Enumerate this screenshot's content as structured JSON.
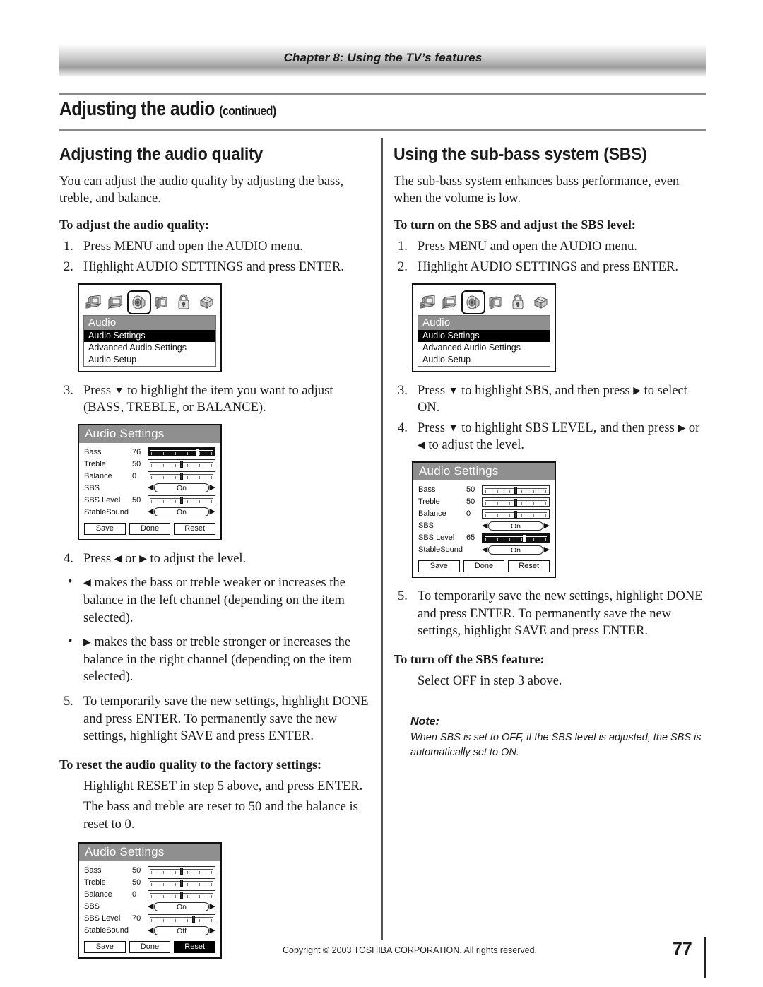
{
  "header": {
    "chapter": "Chapter 8: Using the TV’s features"
  },
  "title": {
    "main": "Adjusting the audio",
    "continued": "(continued)"
  },
  "left": {
    "heading": "Adjusting the audio quality",
    "intro": "You can adjust the audio quality by adjusting the bass, treble, and balance.",
    "subhead1": "To adjust the audio quality:",
    "step1": "Press MENU and open the AUDIO menu.",
    "step2": "Highlight AUDIO SETTINGS and press ENTER.",
    "step1_num": "1.",
    "step2_num": "2.",
    "step3_num": "3.",
    "step4_num": "4.",
    "step5_num": "5.",
    "step3_a": "Press",
    "step3_b": "to highlight the item you want to adjust (BASS, TREBLE, or BALANCE).",
    "step4_a": "Press",
    "step4_b": "or",
    "step4_c": "to adjust the level.",
    "bullet1": "makes the bass or treble weaker or increases the balance in the left channel (depending on the item selected).",
    "bullet2": "makes the bass or treble stronger or increases the balance in the right channel (depending on the item selected).",
    "step5": "To temporarily save the new settings, highlight DONE and press ENTER. To permanently save the new settings, highlight SAVE and press ENTER.",
    "subhead2": "To reset the audio quality to the factory settings:",
    "reset_line1": "Highlight RESET in step 5 above, and press ENTER.",
    "reset_line2": "The bass and treble are reset to 50 and the balance is reset to 0."
  },
  "right": {
    "heading": "Using the sub-bass system (SBS)",
    "intro": "The sub-bass system enhances bass performance, even when the volume is low.",
    "subhead1": "To turn on the SBS and adjust the SBS level:",
    "step1_num": "1.",
    "step2_num": "2.",
    "step3_num": "3.",
    "step4_num": "4.",
    "step5_num": "5.",
    "step1": "Press MENU and open the AUDIO menu.",
    "step2": "Highlight AUDIO SETTINGS and press ENTER.",
    "step3_a": "Press",
    "step3_b": "to highlight SBS, and then press",
    "step3_c": "to select ON.",
    "step4_a": "Press",
    "step4_b": "to highlight SBS LEVEL, and then press",
    "step4_c": "or",
    "step4_d": "to adjust the level.",
    "step5": "To temporarily save the new settings, highlight DONE and press ENTER. To permanently save the new settings, highlight SAVE and press ENTER.",
    "subhead2": "To turn off the SBS feature:",
    "turnoff_line": "Select OFF in step 3 above.",
    "note_title": "Note:",
    "note_body": "When SBS is set to OFF, if the SBS level is adjusted, the SBS is automatically set to ON."
  },
  "osd_menu": {
    "title": "Audio",
    "items": [
      "Audio Settings",
      "Advanced Audio Settings",
      "Audio Setup"
    ],
    "highlighted_index": 0,
    "icons": [
      "picture-icon",
      "tv-icon",
      "speaker-icon",
      "channels-icon",
      "lock-icon",
      "setup-icon"
    ],
    "selected_icon_index": 2
  },
  "panel_a": {
    "title": "Audio Settings",
    "rows": [
      {
        "label": "Bass",
        "value": "76",
        "type": "slider",
        "pct": 76,
        "selected": true
      },
      {
        "label": "Treble",
        "value": "50",
        "type": "slider",
        "pct": 50,
        "selected": false
      },
      {
        "label": "Balance",
        "value": "0",
        "type": "slider",
        "pct": 50,
        "selected": false
      },
      {
        "label": "SBS",
        "value": "",
        "type": "select",
        "option": "On",
        "selected": false
      },
      {
        "label": "SBS Level",
        "value": "50",
        "type": "slider",
        "pct": 50,
        "selected": false
      },
      {
        "label": "StableSound",
        "value": "",
        "type": "select",
        "option": "On",
        "selected": false
      }
    ],
    "buttons": [
      {
        "label": "Save",
        "highlighted": false
      },
      {
        "label": "Done",
        "highlighted": false
      },
      {
        "label": "Reset",
        "highlighted": false
      }
    ]
  },
  "panel_b": {
    "title": "Audio Settings",
    "rows": [
      {
        "label": "Bass",
        "value": "50",
        "type": "slider",
        "pct": 50,
        "selected": false
      },
      {
        "label": "Treble",
        "value": "50",
        "type": "slider",
        "pct": 50,
        "selected": false
      },
      {
        "label": "Balance",
        "value": "0",
        "type": "slider",
        "pct": 50,
        "selected": false
      },
      {
        "label": "SBS",
        "value": "",
        "type": "select",
        "option": "On",
        "selected": false
      },
      {
        "label": "SBS Level",
        "value": "65",
        "type": "slider",
        "pct": 65,
        "selected": true
      },
      {
        "label": "StableSound",
        "value": "",
        "type": "select",
        "option": "On",
        "selected": false
      }
    ],
    "buttons": [
      {
        "label": "Save",
        "highlighted": false
      },
      {
        "label": "Done",
        "highlighted": false
      },
      {
        "label": "Reset",
        "highlighted": false
      }
    ]
  },
  "panel_c": {
    "title": "Audio Settings",
    "rows": [
      {
        "label": "Bass",
        "value": "50",
        "type": "slider",
        "pct": 50,
        "selected": false
      },
      {
        "label": "Treble",
        "value": "50",
        "type": "slider",
        "pct": 50,
        "selected": false
      },
      {
        "label": "Balance",
        "value": "0",
        "type": "slider",
        "pct": 50,
        "selected": false
      },
      {
        "label": "SBS",
        "value": "",
        "type": "select",
        "option": "On",
        "selected": false
      },
      {
        "label": "SBS Level",
        "value": "70",
        "type": "slider",
        "pct": 70,
        "selected": false
      },
      {
        "label": "StableSound",
        "value": "",
        "type": "select",
        "option": "Off",
        "selected": false
      }
    ],
    "buttons": [
      {
        "label": "Save",
        "highlighted": false
      },
      {
        "label": "Done",
        "highlighted": false
      },
      {
        "label": "Reset",
        "highlighted": true
      }
    ]
  },
  "footer": {
    "copyright": "Copyright © 2003 TOSHIBA CORPORATION. All rights reserved.",
    "page_number": "77"
  },
  "glyphs": {
    "down": "▼",
    "left": "◀",
    "right": "▶",
    "bullet": "•"
  }
}
